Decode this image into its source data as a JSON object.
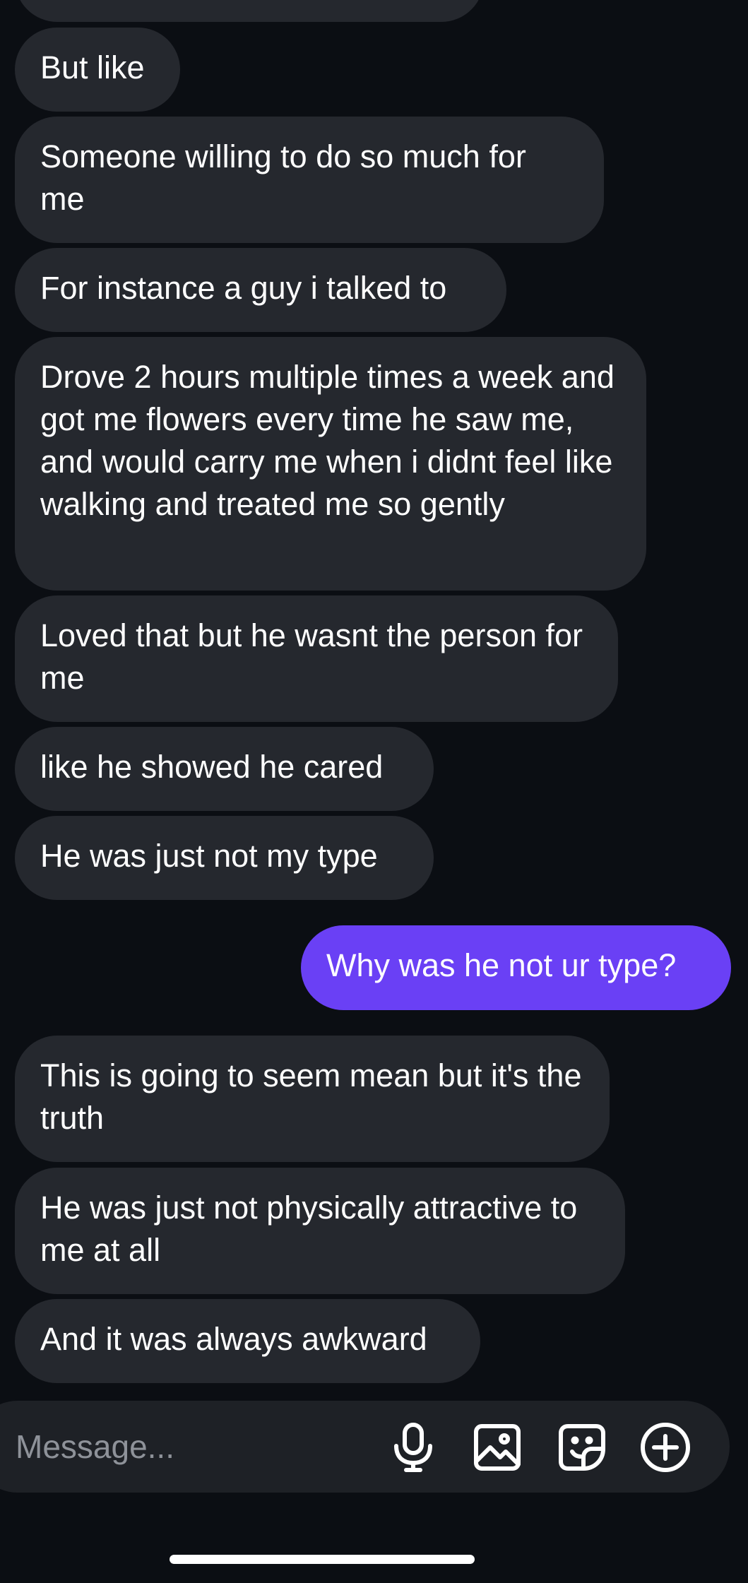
{
  "thread": {
    "messages": [
      {
        "direction": "incoming",
        "text": "But like"
      },
      {
        "direction": "incoming",
        "text": "Someone willing to do so much for me"
      },
      {
        "direction": "incoming",
        "text": "For instance a guy i talked to"
      },
      {
        "direction": "incoming",
        "text": "Drove 2 hours multiple times a week and got me flowers every time he saw me, and would carry me when i didnt feel like walking and treated me so gently"
      },
      {
        "direction": "incoming",
        "text": "Loved that but he wasnt the person for me"
      },
      {
        "direction": "incoming",
        "text": "like he showed he cared"
      },
      {
        "direction": "incoming",
        "text": "He was just not my type"
      },
      {
        "direction": "outgoing",
        "text": "Why was he not ur type?"
      },
      {
        "direction": "incoming",
        "text": "This is going to seem mean but it's the truth"
      },
      {
        "direction": "incoming",
        "text": "He was just not physically attractive to me at all"
      },
      {
        "direction": "incoming",
        "text": "And it was always awkward"
      }
    ]
  },
  "composer": {
    "placeholder": "Message...",
    "icons": [
      "microphone-icon",
      "image-icon",
      "sticker-icon",
      "plus-circle-icon"
    ]
  },
  "colors": {
    "background": "#0b0e13",
    "incoming_bubble": "#25282e",
    "outgoing_bubble": "#6a40f5",
    "composer": "#1e2126",
    "placeholder": "#8e9299"
  }
}
